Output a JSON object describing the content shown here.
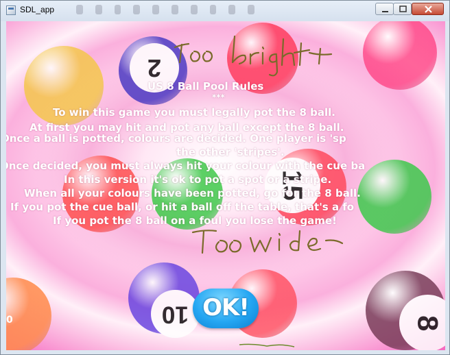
{
  "window": {
    "title": "SDL_app"
  },
  "rules": {
    "heading": "US 8 Ball Pool Rules",
    "stars": "***",
    "lines": [
      "To win this game you must legally pot the 8 ball.",
      "At first you may hit and pot any ball except the 8 ball.",
      "Once a ball is potted, colours are decided. One player is 'sp",
      "the other 'stripes'.",
      "Once decided, you must always hit your colour with the cue ba",
      "In this version it's ok to pot a spot or a stripe.",
      "When all your colours have been potted, go for the 8 ball.",
      "If you pot the cue ball, or hit a ball off the table, that's a fo",
      "If you pot the 8 ball on a foul you lose the game!"
    ]
  },
  "ok_button": {
    "label": "OK!"
  },
  "edge_text": "0",
  "balls": [
    {
      "name": "ball-yellow",
      "color": "#f4c64c",
      "number": ""
    },
    {
      "name": "ball-2-blue",
      "color": "#4d3cc4",
      "number": "2"
    },
    {
      "name": "ball-red-top",
      "color": "#ff3d5e",
      "number": ""
    },
    {
      "name": "ball-pink-right",
      "color": "#ff4b8a",
      "number": ""
    },
    {
      "name": "ball-red-left",
      "color": "#ff5050",
      "number": ""
    },
    {
      "name": "ball-green",
      "color": "#3fc94a",
      "number": ""
    },
    {
      "name": "ball-15-red",
      "color": "#ff4a5e",
      "number": "15"
    },
    {
      "name": "ball-green-right",
      "color": "#3ec84c",
      "number": ""
    },
    {
      "name": "ball-10-purple",
      "color": "#6b47e0",
      "number": "10"
    },
    {
      "name": "ball-red-bottom",
      "color": "#ff5465",
      "number": ""
    },
    {
      "name": "ball-8-dark",
      "color": "#7a3d5a",
      "number": "8"
    },
    {
      "name": "ball-orange-left",
      "color": "#ff8a4a",
      "number": ""
    }
  ],
  "annotations": {
    "top_note": "too bright",
    "middle_note": "Too wide",
    "ink_color": "#7a6a2a"
  }
}
